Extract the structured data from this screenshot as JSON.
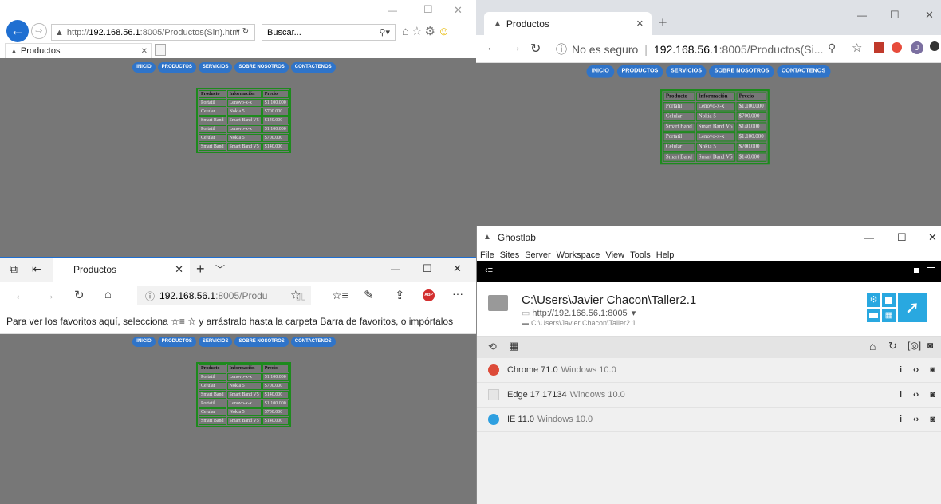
{
  "site_nav": [
    "INICIO",
    "PRODUCTOS",
    "SERVICIOS",
    "SOBRE NOSOTROS",
    "CONTACTENOS"
  ],
  "table": {
    "headers": [
      "Producto",
      "Información",
      "Precio"
    ],
    "rows": [
      [
        "Portatil",
        "Lenovo-x-x",
        "$1.100.000"
      ],
      [
        "Celular",
        "Nokia 5",
        "$700.000"
      ],
      [
        "Smart Band",
        "Smart Band V5",
        "$140.000"
      ],
      [
        "Portatil",
        "Lenovo-x-x",
        "$1.100.000"
      ],
      [
        "Celular",
        "Nokia 5",
        "$700.000"
      ],
      [
        "Smart Band",
        "Smart Band V5",
        "$140.000"
      ]
    ]
  },
  "ie": {
    "url_prefix": "http://",
    "url_host": "192.168.56.1",
    "url_rest": ":8005/Productos(Sin).htm",
    "search_placeholder": "Buscar...",
    "tab_title": "Productos",
    "min": "—",
    "max": "☐",
    "close": "✕"
  },
  "chrome": {
    "tab_title": "Productos",
    "security": "No es seguro",
    "url_host": "192.168.56.1",
    "url_rest": ":8005/Productos(Si...",
    "avatar": "J",
    "min": "—",
    "max": "☐",
    "close": "✕"
  },
  "edge": {
    "tab_title": "Productos",
    "url_host": "192.168.56.1",
    "url_rest": ":8005/Produ",
    "favorites_bar": "Para ver los favoritos aquí, selecciona ☆≡ ☆ y arrástralo hasta la carpeta Barra de favoritos, o impórtalos",
    "abp": "ABP",
    "min": "—",
    "max": "☐",
    "close": "✕"
  },
  "ghostlab": {
    "title": "Ghostlab",
    "menu": [
      "File",
      "Sites",
      "Server",
      "Workspace",
      "View",
      "Tools",
      "Help"
    ],
    "project_path": "C:\\Users\\Javier Chacon\\Taller2.1",
    "server_url": "http://192.168.56.1:8005",
    "folder_path": "C:\\Users\\Javier Chacon\\Taller2.1",
    "clients": [
      {
        "name": "Chrome 71.0",
        "os": "Windows 10.0",
        "icon": "chrome-icon",
        "color": "#dd4b39"
      },
      {
        "name": "Edge 17.17134",
        "os": "Windows 10.0",
        "icon": "edge-icon",
        "color": "#e6e6e6"
      },
      {
        "name": "IE 11.0",
        "os": "Windows 10.0",
        "icon": "ie-icon",
        "color": "#2e9fe0"
      }
    ],
    "min": "—",
    "max": "☐",
    "close": "✕"
  },
  "colors": {
    "page_bg": "#777777",
    "nav_btn": "#2f74c9",
    "table_border": "#1d8a1d",
    "ghost_blue": "#29a8e0"
  }
}
